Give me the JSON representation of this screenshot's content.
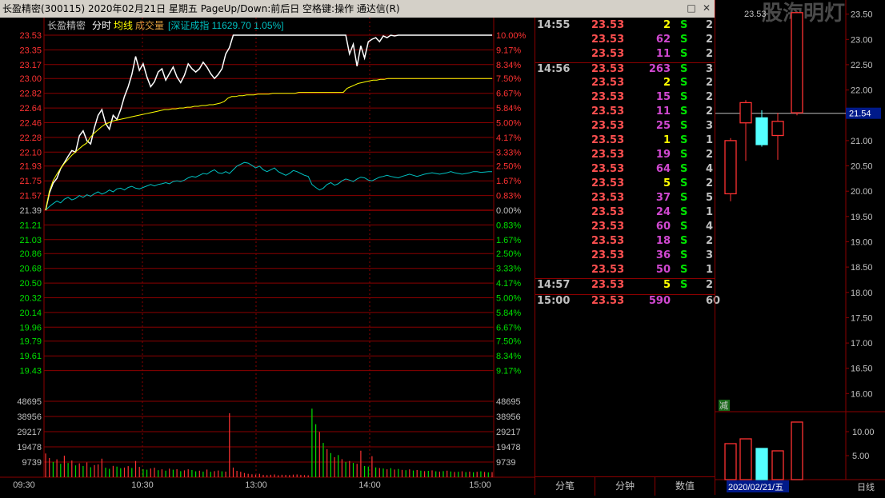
{
  "window": {
    "title": "长盈精密(300115)  2020年02月21日 星期五  PageUp/Down:前后日  空格键:操作  通达信(R)",
    "btn_restore": "□",
    "btn_close": "✕"
  },
  "chart": {
    "stock_name": "长盈精密",
    "tab_time": "分时",
    "tab_avg": "均线",
    "tab_vol": "成交量",
    "index_info": "[深证成指 11629.70 1.05%]",
    "price_labels": [
      "23.53",
      "23.35",
      "23.17",
      "23.00",
      "22.82",
      "22.64",
      "22.46",
      "22.28",
      "22.10",
      "21.93",
      "21.75",
      "21.57",
      "21.39",
      "21.21",
      "21.03",
      "20.86",
      "20.68",
      "20.50",
      "20.32",
      "20.14",
      "19.96",
      "19.79",
      "19.61",
      "19.43"
    ],
    "pct_labels": [
      "10.00%",
      "9.17%",
      "8.34%",
      "7.50%",
      "6.67%",
      "5.84%",
      "5.00%",
      "4.17%",
      "3.33%",
      "2.50%",
      "1.67%",
      "0.83%",
      "0.00%",
      "0.83%",
      "1.67%",
      "2.50%",
      "3.33%",
      "4.17%",
      "5.00%",
      "5.84%",
      "6.67%",
      "7.50%",
      "8.34%",
      "9.17%"
    ],
    "vol_labels": [
      "48695",
      "38956",
      "29217",
      "19478",
      "9739"
    ],
    "time_labels": [
      "09:30",
      "10:30",
      "13:00",
      "14:00",
      "15:00"
    ],
    "colors": {
      "up": "#ff3232",
      "down": "#00e000",
      "grid": "#8b0000",
      "price_line": "#ffffff",
      "avg_line": "#ffff00",
      "index_line": "#00c0c0"
    },
    "price_line": [
      21.39,
      21.6,
      21.72,
      21.78,
      21.9,
      21.97,
      22.05,
      22.12,
      22.1,
      22.3,
      22.36,
      22.24,
      22.2,
      22.4,
      22.55,
      22.62,
      22.45,
      22.38,
      22.55,
      22.5,
      22.62,
      22.78,
      22.9,
      23.05,
      23.27,
      23.1,
      23.18,
      23.02,
      22.9,
      22.96,
      23.08,
      23.12,
      22.98,
      23.06,
      23.14,
      23.02,
      22.95,
      23.04,
      23.18,
      23.12,
      23.08,
      23.12,
      23.2,
      23.14,
      23.06,
      23.0,
      23.05,
      23.12,
      23.3,
      23.38,
      23.53,
      23.53,
      23.53,
      23.53,
      23.53,
      23.53,
      23.53,
      23.53,
      23.53,
      23.53,
      23.53,
      23.53,
      23.53,
      23.53,
      23.53,
      23.53,
      23.53,
      23.53,
      23.53,
      23.53,
      23.53,
      23.53,
      23.53,
      23.53,
      23.53,
      23.53,
      23.53,
      23.53,
      23.53,
      23.53,
      23.53,
      23.3,
      23.42,
      23.15,
      23.4,
      23.25,
      23.45,
      23.48,
      23.5,
      23.45,
      23.52,
      23.5,
      23.53,
      23.52,
      23.53,
      23.53,
      23.53,
      23.53,
      23.53,
      23.53,
      23.53,
      23.53,
      23.53,
      23.53,
      23.53,
      23.53,
      23.53,
      23.53,
      23.53,
      23.53,
      23.53,
      23.53,
      23.53,
      23.53,
      23.53,
      23.53,
      23.53,
      23.53,
      23.53,
      23.53
    ],
    "avg_line": [
      21.39,
      21.62,
      21.75,
      21.83,
      21.9,
      21.96,
      22.01,
      22.06,
      22.1,
      22.14,
      22.18,
      22.21,
      22.28,
      22.33,
      22.37,
      22.41,
      22.44,
      22.46,
      22.48,
      22.49,
      22.5,
      22.51,
      22.52,
      22.53,
      22.54,
      22.55,
      22.56,
      22.57,
      22.58,
      22.59,
      22.6,
      22.61,
      22.62,
      22.62,
      22.63,
      22.63,
      22.64,
      22.64,
      22.65,
      22.65,
      22.66,
      22.66,
      22.67,
      22.67,
      22.68,
      22.68,
      22.69,
      22.7,
      22.72,
      22.76,
      22.78,
      22.78,
      22.79,
      22.79,
      22.8,
      22.8,
      22.8,
      22.81,
      22.81,
      22.81,
      22.81,
      22.82,
      22.82,
      22.82,
      22.82,
      22.82,
      22.82,
      22.82,
      22.83,
      22.83,
      22.83,
      22.83,
      22.83,
      22.83,
      22.83,
      22.83,
      22.83,
      22.83,
      22.83,
      22.83,
      22.83,
      22.88,
      22.9,
      22.92,
      22.94,
      22.95,
      22.96,
      22.97,
      22.98,
      22.98,
      22.99,
      22.99,
      23.0,
      23.0,
      23.0,
      23.0,
      23.0,
      23.0,
      23.0,
      23.0,
      23.0,
      23.0,
      23.0,
      23.0,
      23.0,
      23.0,
      23.0,
      23.0,
      23.0,
      23.0,
      23.0,
      23.0,
      23.0,
      23.0,
      23.0,
      23.0,
      23.0,
      23.0,
      23.0,
      23.0,
      23.0
    ],
    "index_line_pct": [
      0.0,
      0.1,
      0.18,
      0.25,
      0.2,
      0.3,
      0.35,
      0.28,
      0.32,
      0.4,
      0.35,
      0.42,
      0.38,
      0.45,
      0.5,
      0.44,
      0.48,
      0.55,
      0.5,
      0.58,
      0.6,
      0.55,
      0.62,
      0.65,
      0.6,
      0.58,
      0.62,
      0.66,
      0.7,
      0.66,
      0.7,
      0.72,
      0.75,
      0.72,
      0.78,
      0.8,
      0.78,
      0.82,
      0.88,
      0.92,
      0.9,
      0.95,
      1.0,
      0.98,
      1.05,
      1.1,
      1.02,
      1.0,
      1.05,
      1.0,
      1.1,
      1.2,
      1.25,
      1.3,
      1.28,
      1.22,
      1.15,
      1.2,
      1.1,
      1.05,
      1.1,
      1.15,
      1.05,
      1.0,
      0.95,
      1.0,
      1.08,
      1.05,
      1.0,
      0.95,
      0.92,
      0.7,
      0.62,
      0.55,
      0.6,
      0.7,
      0.75,
      0.68,
      0.72,
      0.8,
      0.85,
      0.82,
      0.78,
      0.85,
      0.9,
      0.88,
      0.82,
      0.8,
      0.85,
      0.9,
      0.92,
      0.95,
      0.92,
      0.9,
      0.88,
      0.92,
      0.95,
      0.98,
      0.95,
      0.92,
      0.95,
      0.98,
      1.0,
      1.02,
      1.0,
      0.98,
      1.0,
      1.02,
      1.05,
      1.02,
      1.0,
      0.98,
      1.0,
      1.02,
      1.05,
      1.05,
      1.03,
      1.04,
      1.05,
      1.05
    ],
    "volumes": [
      15200,
      12300,
      9800,
      11500,
      8600,
      13800,
      9100,
      10700,
      7600,
      8900,
      7200,
      9500,
      6400,
      7800,
      8200,
      11900,
      6100,
      5400,
      7300,
      6800,
      5800,
      6200,
      7100,
      5900,
      10400,
      6600,
      5200,
      4800,
      5600,
      6100,
      4500,
      5100,
      4200,
      5500,
      4800,
      5200,
      3900,
      4400,
      5100,
      4600,
      3800,
      4200,
      3600,
      4900,
      3500,
      3900,
      4300,
      3800,
      3600,
      41000,
      6200,
      4100,
      3500,
      2700,
      2200,
      1900,
      1700,
      2200,
      1500,
      1400,
      1600,
      1800,
      1300,
      1600,
      1500,
      1400,
      1700,
      1800,
      1500,
      1400,
      1300,
      44000,
      34000,
      29000,
      22000,
      18000,
      15500,
      12800,
      14200,
      11600,
      9800,
      10400,
      9200,
      8600,
      17000,
      7200,
      6800,
      13500,
      6300,
      5900,
      5600,
      5100,
      5800,
      4900,
      5300,
      4700,
      4500,
      5000,
      4300,
      4600,
      4200,
      3900,
      4100,
      4400,
      3800,
      3600,
      3900,
      4200,
      3700,
      3400,
      3500,
      3800,
      3300,
      3600,
      3200,
      3500,
      3800,
      3400,
      3100,
      3300
    ],
    "volume_up": [
      true,
      true,
      false,
      true,
      false,
      true,
      false,
      true,
      false,
      true,
      false,
      true,
      false,
      true,
      true,
      true,
      false,
      false,
      true,
      false,
      false,
      true,
      true,
      false,
      true,
      true,
      false,
      false,
      true,
      true,
      false,
      true,
      false,
      true,
      false,
      true,
      false,
      true,
      true,
      false,
      false,
      true,
      false,
      true,
      false,
      true,
      true,
      false,
      true,
      true,
      true,
      true,
      true,
      true,
      true,
      true,
      true,
      true,
      true,
      true,
      true,
      true,
      true,
      true,
      true,
      true,
      true,
      true,
      true,
      true,
      true,
      false,
      false,
      true,
      false,
      true,
      false,
      true,
      false,
      true,
      false,
      true,
      false,
      true,
      true,
      false,
      false,
      true,
      false,
      true,
      false,
      true,
      false,
      true,
      false,
      true,
      false,
      true,
      false,
      true,
      false,
      true,
      false,
      true,
      false,
      true,
      false,
      true,
      false,
      true,
      false,
      true,
      false,
      true,
      false,
      true,
      false,
      true,
      false,
      true
    ],
    "ylim": [
      19.25,
      23.53
    ],
    "prev_close": 21.39,
    "vol_max": 48695
  },
  "trades": {
    "rows": [
      {
        "time": "14:55",
        "price": "23.53",
        "vol": "2",
        "dir": "S",
        "cnt": "2",
        "vcolor": "y"
      },
      {
        "time": "",
        "price": "23.53",
        "vol": "62",
        "dir": "S",
        "cnt": "2",
        "vcolor": "p"
      },
      {
        "time": "",
        "price": "23.53",
        "vol": "11",
        "dir": "S",
        "cnt": "2",
        "vcolor": "p"
      },
      {
        "time": "14:56",
        "price": "23.53",
        "vol": "263",
        "dir": "S",
        "cnt": "3",
        "vcolor": "p"
      },
      {
        "time": "",
        "price": "23.53",
        "vol": "2",
        "dir": "S",
        "cnt": "2",
        "vcolor": "y"
      },
      {
        "time": "",
        "price": "23.53",
        "vol": "15",
        "dir": "S",
        "cnt": "2",
        "vcolor": "p"
      },
      {
        "time": "",
        "price": "23.53",
        "vol": "11",
        "dir": "S",
        "cnt": "2",
        "vcolor": "p"
      },
      {
        "time": "",
        "price": "23.53",
        "vol": "25",
        "dir": "S",
        "cnt": "3",
        "vcolor": "p"
      },
      {
        "time": "",
        "price": "23.53",
        "vol": "1",
        "dir": "S",
        "cnt": "1",
        "vcolor": "y"
      },
      {
        "time": "",
        "price": "23.53",
        "vol": "19",
        "dir": "S",
        "cnt": "2",
        "vcolor": "p"
      },
      {
        "time": "",
        "price": "23.53",
        "vol": "64",
        "dir": "S",
        "cnt": "4",
        "vcolor": "p"
      },
      {
        "time": "",
        "price": "23.53",
        "vol": "5",
        "dir": "S",
        "cnt": "2",
        "vcolor": "y"
      },
      {
        "time": "",
        "price": "23.53",
        "vol": "37",
        "dir": "S",
        "cnt": "5",
        "vcolor": "p"
      },
      {
        "time": "",
        "price": "23.53",
        "vol": "24",
        "dir": "S",
        "cnt": "1",
        "vcolor": "p"
      },
      {
        "time": "",
        "price": "23.53",
        "vol": "60",
        "dir": "S",
        "cnt": "4",
        "vcolor": "p"
      },
      {
        "time": "",
        "price": "23.53",
        "vol": "18",
        "dir": "S",
        "cnt": "2",
        "vcolor": "p"
      },
      {
        "time": "",
        "price": "23.53",
        "vol": "36",
        "dir": "S",
        "cnt": "3",
        "vcolor": "p"
      },
      {
        "time": "",
        "price": "23.53",
        "vol": "50",
        "dir": "S",
        "cnt": "1",
        "vcolor": "p"
      },
      {
        "time": "14:57",
        "price": "23.53",
        "vol": "5",
        "dir": "S",
        "cnt": "2",
        "vcolor": "y"
      },
      {
        "time": "15:00",
        "price": "23.53",
        "vol": "590",
        "dir": "",
        "cnt": "60",
        "vcolor": "p"
      }
    ],
    "tabs": [
      "分笔",
      "分钟",
      "数值"
    ]
  },
  "kline": {
    "top_label": "23.53",
    "watermark": "股海明灯",
    "axis": [
      "23.50",
      "23.00",
      "22.50",
      "22.00",
      "21.50",
      "21.00",
      "20.50",
      "20.00",
      "19.50",
      "19.00",
      "18.50",
      "18.00",
      "17.50",
      "17.00",
      "16.50",
      "16.00"
    ],
    "current_price": "21.54",
    "vol_axis": [
      "10.00",
      "5.00"
    ],
    "minus_label": "减",
    "date_label": "2020/02/21/五",
    "period": "日线",
    "candles": [
      {
        "o": 19.95,
        "c": 21.0,
        "h": 21.05,
        "l": 19.8,
        "v": 7.5
      },
      {
        "o": 21.35,
        "c": 21.75,
        "h": 21.8,
        "l": 20.6,
        "v": 8.5
      },
      {
        "o": 21.45,
        "c": 20.92,
        "h": 21.6,
        "l": 20.88,
        "v": 6.5
      },
      {
        "o": 21.1,
        "c": 21.38,
        "h": 21.55,
        "l": 20.62,
        "v": 6.0
      },
      {
        "o": 21.55,
        "c": 23.53,
        "h": 23.53,
        "l": 21.5,
        "v": 12.0
      }
    ],
    "kylim": [
      15.8,
      23.7
    ],
    "kvol_max": 13
  }
}
